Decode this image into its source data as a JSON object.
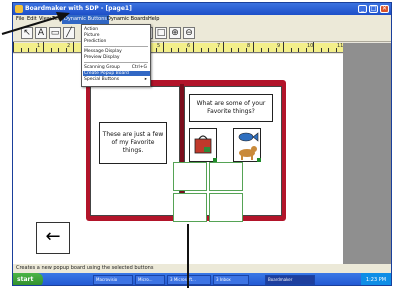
{
  "window": {
    "title": "Boardmaker with SDP - [page1]",
    "controls": [
      "_",
      "□",
      "✕"
    ]
  },
  "menubar": {
    "items": [
      "File",
      "Edit",
      "View",
      "Text",
      "Dynamic Buttons",
      "Dynamic Boards",
      "Help"
    ],
    "active_index": 4
  },
  "dropdown": {
    "items": [
      {
        "label": "Action",
        "shortcut": ""
      },
      {
        "label": "Picture",
        "shortcut": ""
      },
      {
        "label": "Prediction",
        "shortcut": ""
      },
      {
        "label": "Message Display",
        "shortcut": ""
      },
      {
        "label": "Preview Display",
        "shortcut": ""
      },
      {
        "label": "Scanning Group",
        "shortcut": "Ctrl+G"
      },
      {
        "label": "Create Popup Board",
        "shortcut": ""
      },
      {
        "label": "Special Buttons",
        "shortcut": "▸"
      }
    ],
    "highlight_index": 6
  },
  "ruler": {
    "numbers": [
      "1",
      "2",
      "3",
      "4",
      "5",
      "6",
      "7",
      "8",
      "9",
      "10",
      "11"
    ]
  },
  "board": {
    "left_text": "These are just a few of my Favorite things.",
    "right_text": "What are some of your Favorite things?",
    "cells": [
      {
        "icon": "lunchbox-icon",
        "color": "#c0392b"
      },
      {
        "icon": "fish-icon",
        "color": "#2f6fbf"
      },
      {
        "icon": "dog-icon",
        "color": "#c98a3a"
      }
    ],
    "popup_cells": 4,
    "back_arrow": "←"
  },
  "status": {
    "text": "Creates a new popup board using the selected buttons"
  },
  "taskbar": {
    "start_label": "start",
    "tasks": [
      "Macrovisio",
      "Micro...",
      "3 Microsoft...",
      "3 Inbox",
      "Boardmaker"
    ],
    "active_task_index": 4,
    "clock": "1:23 PM"
  }
}
